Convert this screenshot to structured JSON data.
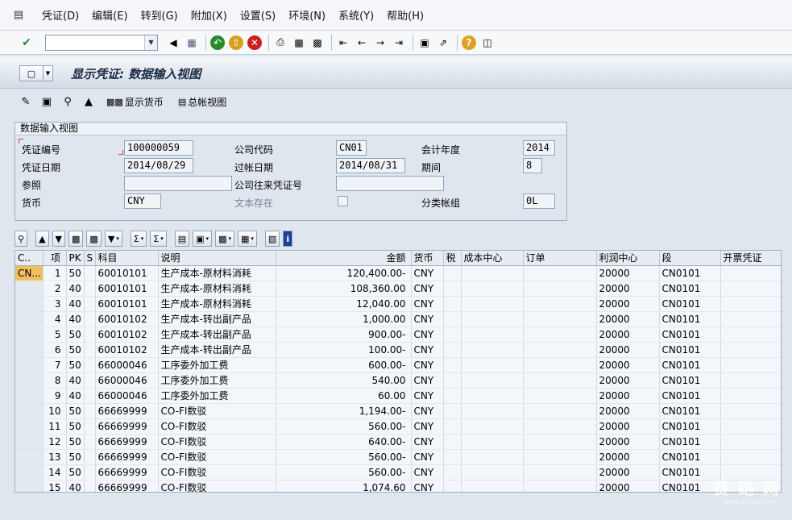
{
  "menu": {
    "items": [
      "凭证(D)",
      "编辑(E)",
      "转到(G)",
      "附加(X)",
      "设置(S)",
      "环境(N)",
      "系统(Y)",
      "帮助(H)"
    ]
  },
  "standard_toolbar": {
    "command_field_value": "",
    "icons": [
      "enter-icon",
      "back-icon",
      "save-icon",
      "back-green-icon",
      "exit-icon",
      "cancel-icon",
      "print-icon",
      "find-icon",
      "find-next-icon",
      "first-page-icon",
      "prev-page-icon",
      "next-page-icon",
      "last-page-icon",
      "create-session-icon",
      "shortcut-icon",
      "help-icon",
      "layout-icon"
    ]
  },
  "title": {
    "text": "显示凭证: 数据输入视图"
  },
  "app_toolbar": {
    "display_currency_label": "显示货币",
    "general_ledger_view_label": "总帐视图"
  },
  "header": {
    "box_title": "数据输入视图",
    "doc_number_label": "凭证编号",
    "doc_number": "100000059",
    "company_code_label": "公司代码",
    "company_code": "CN01",
    "fiscal_year_label": "会计年度",
    "fiscal_year": "2014",
    "doc_date_label": "凭证日期",
    "doc_date": "2014/08/29",
    "posting_date_label": "过帐日期",
    "posting_date": "2014/08/31",
    "period_label": "期间",
    "period": "8",
    "reference_label": "参照",
    "reference": "",
    "intercompany_label": "公司往来凭证号",
    "intercompany": "",
    "currency_label": "货币",
    "currency": "CNY",
    "text_exists_label": "文本存在",
    "ledger_group_label": "分类帐组",
    "ledger_group": "0L"
  },
  "grid": {
    "columns": [
      "C..",
      "项",
      "PK",
      "S",
      "科目",
      "说明",
      "金额",
      "货币",
      "税",
      "成本中心",
      "订单",
      "利润中心",
      "段",
      "开票凭证"
    ],
    "rows": [
      {
        "c": "CN...",
        "item": "1",
        "pk": "50",
        "s": "",
        "account": "60010101",
        "desc": "生产成本-原材料消耗",
        "amount": "120,400.00-",
        "curr": "CNY",
        "tax": "",
        "cc": "",
        "order": "",
        "pc": "20000",
        "seg": "CN0101",
        "billing": ""
      },
      {
        "c": "",
        "item": "2",
        "pk": "40",
        "s": "",
        "account": "60010101",
        "desc": "生产成本-原材料消耗",
        "amount": "108,360.00",
        "curr": "CNY",
        "tax": "",
        "cc": "",
        "order": "",
        "pc": "20000",
        "seg": "CN0101",
        "billing": ""
      },
      {
        "c": "",
        "item": "3",
        "pk": "40",
        "s": "",
        "account": "60010101",
        "desc": "生产成本-原材料消耗",
        "amount": "12,040.00",
        "curr": "CNY",
        "tax": "",
        "cc": "",
        "order": "",
        "pc": "20000",
        "seg": "CN0101",
        "billing": ""
      },
      {
        "c": "",
        "item": "4",
        "pk": "40",
        "s": "",
        "account": "60010102",
        "desc": "生产成本-转出副产品",
        "amount": "1,000.00",
        "curr": "CNY",
        "tax": "",
        "cc": "",
        "order": "",
        "pc": "20000",
        "seg": "CN0101",
        "billing": ""
      },
      {
        "c": "",
        "item": "5",
        "pk": "50",
        "s": "",
        "account": "60010102",
        "desc": "生产成本-转出副产品",
        "amount": "900.00-",
        "curr": "CNY",
        "tax": "",
        "cc": "",
        "order": "",
        "pc": "20000",
        "seg": "CN0101",
        "billing": ""
      },
      {
        "c": "",
        "item": "6",
        "pk": "50",
        "s": "",
        "account": "60010102",
        "desc": "生产成本-转出副产品",
        "amount": "100.00-",
        "curr": "CNY",
        "tax": "",
        "cc": "",
        "order": "",
        "pc": "20000",
        "seg": "CN0101",
        "billing": ""
      },
      {
        "c": "",
        "item": "7",
        "pk": "50",
        "s": "",
        "account": "66000046",
        "desc": "工序委外加工费",
        "amount": "600.00-",
        "curr": "CNY",
        "tax": "",
        "cc": "",
        "order": "",
        "pc": "20000",
        "seg": "CN0101",
        "billing": ""
      },
      {
        "c": "",
        "item": "8",
        "pk": "40",
        "s": "",
        "account": "66000046",
        "desc": "工序委外加工费",
        "amount": "540.00",
        "curr": "CNY",
        "tax": "",
        "cc": "",
        "order": "",
        "pc": "20000",
        "seg": "CN0101",
        "billing": ""
      },
      {
        "c": "",
        "item": "9",
        "pk": "40",
        "s": "",
        "account": "66000046",
        "desc": "工序委外加工费",
        "amount": "60.00",
        "curr": "CNY",
        "tax": "",
        "cc": "",
        "order": "",
        "pc": "20000",
        "seg": "CN0101",
        "billing": ""
      },
      {
        "c": "",
        "item": "10",
        "pk": "50",
        "s": "",
        "account": "66669999",
        "desc": "CO-FI数驳",
        "amount": "1,194.00-",
        "curr": "CNY",
        "tax": "",
        "cc": "",
        "order": "",
        "pc": "20000",
        "seg": "CN0101",
        "billing": ""
      },
      {
        "c": "",
        "item": "11",
        "pk": "50",
        "s": "",
        "account": "66669999",
        "desc": "CO-FI数驳",
        "amount": "560.00-",
        "curr": "CNY",
        "tax": "",
        "cc": "",
        "order": "",
        "pc": "20000",
        "seg": "CN0101",
        "billing": ""
      },
      {
        "c": "",
        "item": "12",
        "pk": "50",
        "s": "",
        "account": "66669999",
        "desc": "CO-FI数驳",
        "amount": "640.00-",
        "curr": "CNY",
        "tax": "",
        "cc": "",
        "order": "",
        "pc": "20000",
        "seg": "CN0101",
        "billing": ""
      },
      {
        "c": "",
        "item": "13",
        "pk": "50",
        "s": "",
        "account": "66669999",
        "desc": "CO-FI数驳",
        "amount": "560.00-",
        "curr": "CNY",
        "tax": "",
        "cc": "",
        "order": "",
        "pc": "20000",
        "seg": "CN0101",
        "billing": ""
      },
      {
        "c": "",
        "item": "14",
        "pk": "50",
        "s": "",
        "account": "66669999",
        "desc": "CO-FI数驳",
        "amount": "560.00-",
        "curr": "CNY",
        "tax": "",
        "cc": "",
        "order": "",
        "pc": "20000",
        "seg": "CN0101",
        "billing": ""
      },
      {
        "c": "",
        "item": "15",
        "pk": "40",
        "s": "",
        "account": "66669999",
        "desc": "CO-FI数驳",
        "amount": "1,074.60",
        "curr": "CNY",
        "tax": "",
        "cc": "",
        "order": "",
        "pc": "20000",
        "seg": "CN0101",
        "billing": ""
      }
    ]
  },
  "watermark": {
    "text": "赛 跑 网",
    "url": "www.91sap.com"
  },
  "colors": {
    "background": "#dfe6ee",
    "title_text": "#1a2a44",
    "selected_cell": "#f0c060"
  }
}
